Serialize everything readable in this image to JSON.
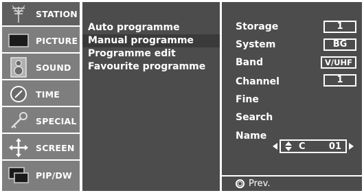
{
  "sidebar": {
    "items": [
      {
        "label": "STATION",
        "icon": "antenna-icon"
      },
      {
        "label": "PICTURE",
        "icon": "tv-screen-icon"
      },
      {
        "label": "SOUND",
        "icon": "speaker-icon"
      },
      {
        "label": "TIME",
        "icon": "clock-icon"
      },
      {
        "label": "SPECIAL",
        "icon": "key-icon"
      },
      {
        "label": "SCREEN",
        "icon": "move-arrows-icon"
      },
      {
        "label": "PIP/DW",
        "icon": "pip-icon"
      }
    ],
    "active_index": 0
  },
  "menu": {
    "items": [
      "Auto programme",
      "Manual programme",
      "Programme edit",
      "Favourite programme"
    ],
    "selected_index": 1
  },
  "settings": {
    "storage": {
      "label": "Storage",
      "value": "1"
    },
    "system": {
      "label": "System",
      "value": "BG"
    },
    "band": {
      "label": "Band",
      "value": "V/UHF"
    },
    "channel": {
      "label": "Channel",
      "value": "1"
    },
    "fine": {
      "label": "Fine"
    },
    "search": {
      "label": "Search"
    },
    "name": {
      "label": "Name",
      "char": "C",
      "number": "01"
    }
  },
  "footer": {
    "prev_label": "Prev."
  },
  "colors": {
    "panel": "#4c4c4c",
    "sidebar": "#7e7e7e",
    "text": "#ffffff"
  }
}
